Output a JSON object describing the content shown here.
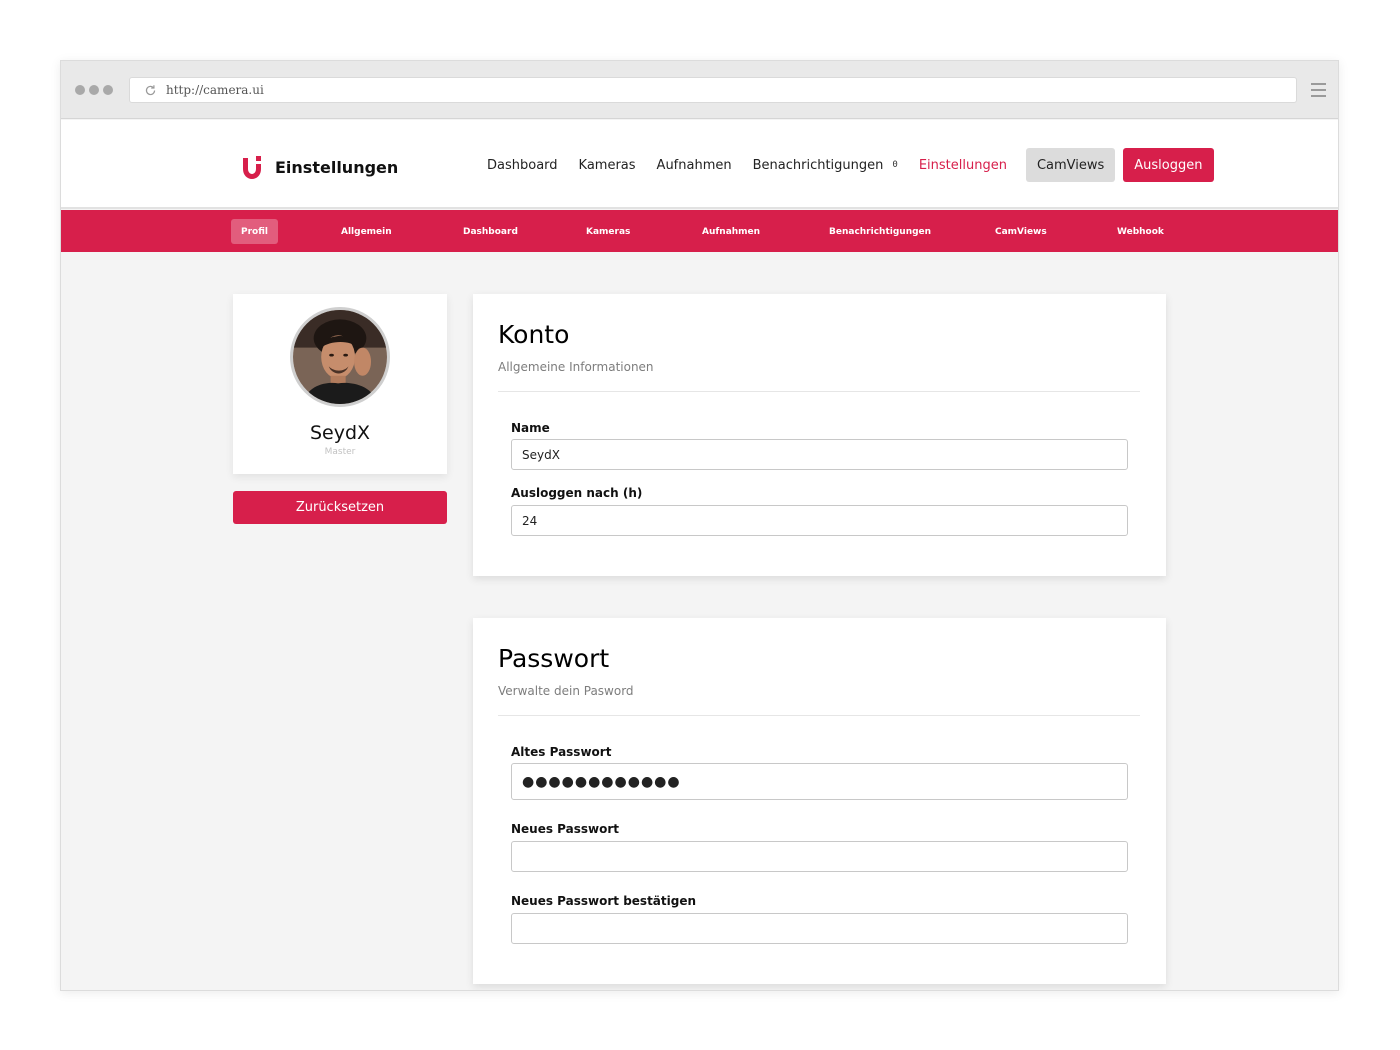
{
  "browser": {
    "url": "http://camera.ui"
  },
  "header": {
    "title": "Einstellungen",
    "links": [
      {
        "label": "Dashboard"
      },
      {
        "label": "Kameras"
      },
      {
        "label": "Aufnahmen"
      },
      {
        "label": "Benachrichtigungen",
        "count": "0"
      },
      {
        "label": "Einstellungen",
        "active": true
      }
    ],
    "camviews_label": "CamViews",
    "logout_label": "Ausloggen"
  },
  "subnav": {
    "items": [
      {
        "label": "Profil",
        "active": true
      },
      {
        "label": "Allgemein"
      },
      {
        "label": "Dashboard"
      },
      {
        "label": "Kameras"
      },
      {
        "label": "Aufnahmen"
      },
      {
        "label": "Benachrichtigungen"
      },
      {
        "label": "CamViews"
      },
      {
        "label": "Webhook"
      }
    ]
  },
  "profile": {
    "name": "SeydX",
    "role": "Master",
    "reset_label": "Zurücksetzen"
  },
  "account": {
    "title": "Konto",
    "subtitle": "Allgemeine Informationen",
    "name_label": "Name",
    "name_value": "SeydX",
    "logout_label": "Ausloggen nach (h)",
    "logout_value": "24"
  },
  "password": {
    "title": "Passwort",
    "subtitle": "Verwalte dein Pasword",
    "old_label": "Altes Passwort",
    "old_value": "●●●●●●●●●●●●",
    "new_label": "Neues Passwort",
    "new_value": "",
    "confirm_label": "Neues Passwort bestätigen",
    "confirm_value": ""
  },
  "colors": {
    "accent": "#d71f4b",
    "background": "#f4f4f4",
    "camviews_button": "#dcdcdc"
  },
  "icons": {
    "logo": "camera-ui-logo-icon",
    "reload": "reload-icon",
    "menu": "hamburger-menu-icon"
  }
}
